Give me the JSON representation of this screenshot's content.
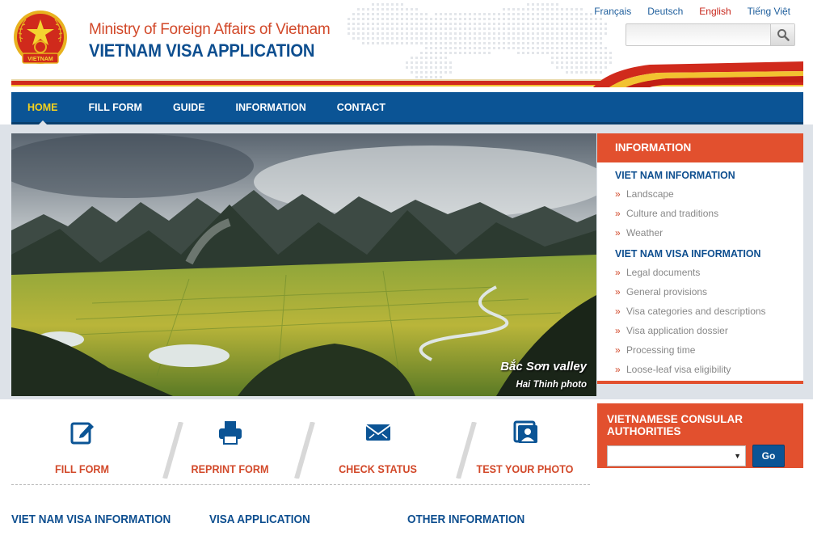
{
  "header": {
    "ministry": "Ministry of Foreign Affairs of Vietnam",
    "app_title": "VIETNAM VISA APPLICATION",
    "emblem_text": "VIETNAM",
    "languages": [
      "Français",
      "Deutsch",
      "English",
      "Tiếng Việt"
    ],
    "active_language": "English",
    "search": {
      "placeholder": "",
      "value": ""
    },
    "search_icon": "magnifier-icon"
  },
  "nav": {
    "items": [
      "HOME",
      "FILL FORM",
      "GUIDE",
      "INFORMATION",
      "CONTACT"
    ],
    "active": "HOME"
  },
  "hero": {
    "caption": "Bắc Sơn valley",
    "credit": "Hai Thinh photo"
  },
  "info": {
    "title": "INFORMATION",
    "sections": [
      {
        "heading": "VIET NAM INFORMATION",
        "items": [
          "Landscape",
          "Culture and traditions",
          "Weather"
        ]
      },
      {
        "heading": "VIET NAM VISA INFORMATION",
        "items": [
          "Legal documents",
          "General provisions",
          "Visa categories and descriptions",
          "Visa application dossier",
          "Processing time",
          "Loose-leaf visa eligibility"
        ]
      }
    ]
  },
  "consular": {
    "title": "VIETNAMESE CONSULAR AUTHORITIES",
    "selected": "",
    "go_label": "Go"
  },
  "actions": [
    {
      "label": "FILL FORM",
      "icon": "edit-form-icon"
    },
    {
      "label": "REPRINT FORM",
      "icon": "printer-icon"
    },
    {
      "label": "CHECK STATUS",
      "icon": "envelope-icon"
    },
    {
      "label": "TEST YOUR PHOTO",
      "icon": "photo-portrait-icon"
    }
  ],
  "bottom": {
    "col1": "VIET NAM VISA INFORMATION",
    "col2": "VISA APPLICATION",
    "col3": "OTHER INFORMATION"
  },
  "colors": {
    "brand_blue": "#0b5495",
    "accent_red": "#e2502e",
    "nav_active": "#f6d21d"
  }
}
